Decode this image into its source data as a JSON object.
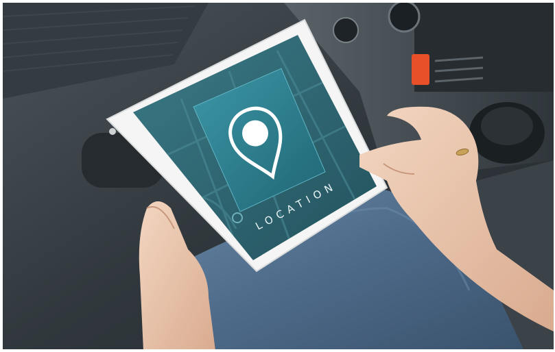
{
  "scene": {
    "colors": {
      "car_interior": "#2a3035",
      "dashboard": "#3a4147",
      "tablet_frame": "#f4f5f4",
      "screen_bg": "#2e6470",
      "app_icon": "#2c7e8e",
      "jeans": "#4f6b8a",
      "skin": "#e9c6ad",
      "radio_button": "#e8502a"
    }
  },
  "tablet_screen": {
    "icon_name": "location-pin-icon",
    "label": "LOCATION"
  }
}
